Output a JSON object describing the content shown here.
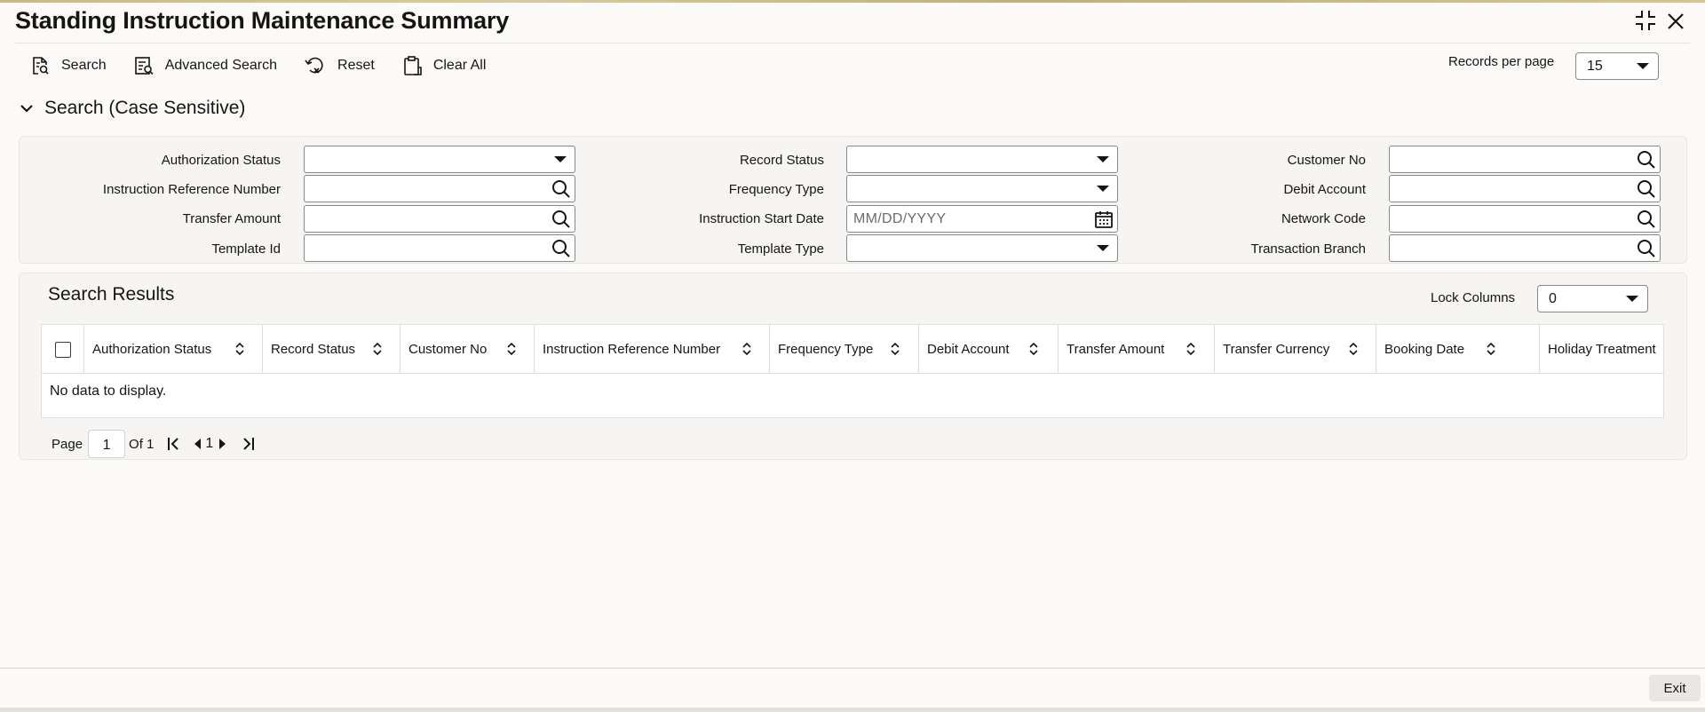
{
  "window": {
    "title": "Standing Instruction Maintenance Summary"
  },
  "toolbar": {
    "search": "Search",
    "advanced_search": "Advanced Search",
    "reset": "Reset",
    "clear_all": "Clear All"
  },
  "records_per_page": {
    "label": "Records per page",
    "value": "15"
  },
  "criteria": {
    "section_title": "Search (Case Sensitive)",
    "authorization_status": {
      "label": "Authorization Status",
      "value": ""
    },
    "instruction_reference_number": {
      "label": "Instruction Reference Number",
      "value": ""
    },
    "transfer_amount": {
      "label": "Transfer Amount",
      "value": ""
    },
    "template_id": {
      "label": "Template Id",
      "value": ""
    },
    "record_status": {
      "label": "Record Status",
      "value": ""
    },
    "frequency_type": {
      "label": "Frequency Type",
      "value": ""
    },
    "instruction_start_date": {
      "label": "Instruction Start Date",
      "placeholder": "MM/DD/YYYY"
    },
    "template_type": {
      "label": "Template Type",
      "value": ""
    },
    "customer_no": {
      "label": "Customer No",
      "value": ""
    },
    "debit_account": {
      "label": "Debit Account",
      "value": ""
    },
    "network_code": {
      "label": "Network Code",
      "value": ""
    },
    "transaction_branch": {
      "label": "Transaction Branch",
      "value": ""
    }
  },
  "results": {
    "title": "Search Results",
    "lock_columns_label": "Lock Columns",
    "lock_columns_value": "0",
    "columns": [
      "Authorization Status",
      "Record Status",
      "Customer No",
      "Instruction Reference Number",
      "Frequency Type",
      "Debit Account",
      "Transfer Amount",
      "Transfer Currency",
      "Booking Date",
      "Holiday Treatment"
    ],
    "empty_message": "No data to display."
  },
  "pagination": {
    "page_label": "Page",
    "page_value": "1",
    "of_label": "Of 1",
    "current": "1"
  },
  "footer": {
    "exit": "Exit"
  }
}
